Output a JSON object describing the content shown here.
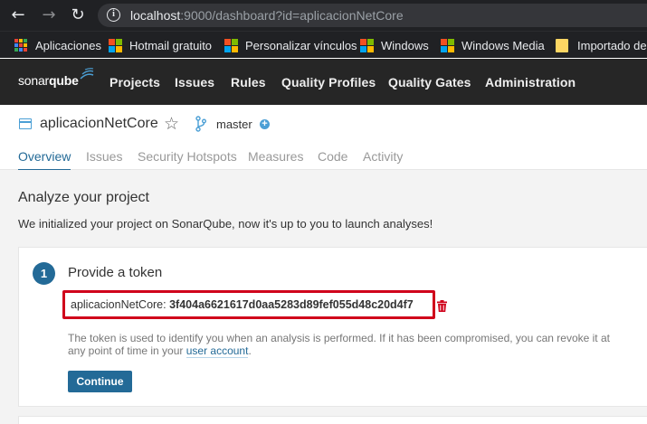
{
  "browser": {
    "url_host": "localhost",
    "url_rest": ":9000/dashboard?id=aplicacionNetCore",
    "bookmarks": [
      {
        "label": "Aplicaciones",
        "icon": "apps-icon"
      },
      {
        "label": "Hotmail gratuito",
        "icon": "microsoft-logo-icon"
      },
      {
        "label": "Personalizar vínculos",
        "icon": "microsoft-logo-icon"
      },
      {
        "label": "Windows",
        "icon": "microsoft-logo-icon"
      },
      {
        "label": "Windows Media",
        "icon": "microsoft-logo-icon"
      },
      {
        "label": "Importado de I",
        "icon": "folder-icon"
      }
    ]
  },
  "sonar_nav": {
    "logo_light": "sonar",
    "logo_bold": "qube",
    "links": [
      "Projects",
      "Issues",
      "Rules",
      "Quality Profiles",
      "Quality Gates",
      "Administration"
    ]
  },
  "component": {
    "name": "aplicacionNetCore",
    "branch": "master",
    "tabs": [
      "Overview",
      "Issues",
      "Security Hotspots",
      "Measures",
      "Code",
      "Activity"
    ],
    "active_tab": "Overview"
  },
  "tutorial": {
    "title": "Analyze your project",
    "description": "We initialized your project on SonarQube, now it's up to you to launch analyses!",
    "step": {
      "number": "1",
      "title": "Provide a token",
      "token_label": "aplicacionNetCore: ",
      "token_value": "3f404a6621617d0aa5283d89fef055d48c20d4f7",
      "help_prefix": "The token is used to identify you when an analysis is performed. If it has been compromised, you can revoke it at any point of time in your ",
      "help_link": "user account",
      "help_suffix": ".",
      "continue_label": "Continue"
    }
  },
  "colors": {
    "accent": "#236a97",
    "highlight_border": "#d0021b",
    "trash": "#d0021b",
    "nav_bg": "#262626"
  }
}
